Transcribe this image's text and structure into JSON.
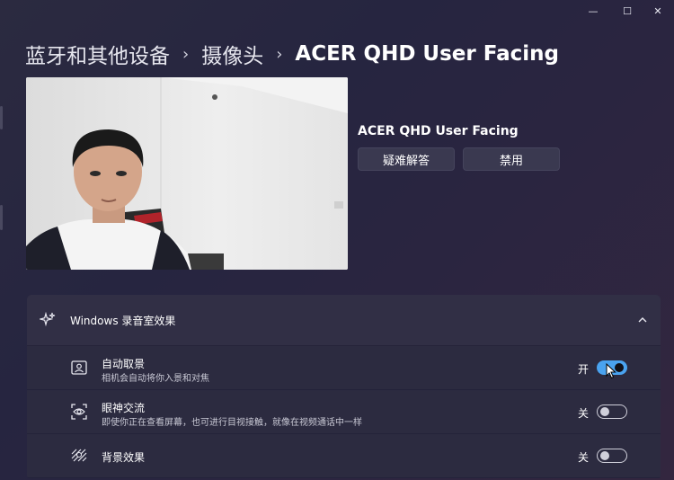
{
  "window": {
    "minimize_glyph": "—",
    "maximize_glyph": "☐",
    "close_glyph": "✕"
  },
  "breadcrumb": {
    "level1": "蓝牙和其他设备",
    "level2": "摄像头",
    "current": "ACER QHD User Facing",
    "separator": "›"
  },
  "camera": {
    "device_name": "ACER QHD User Facing",
    "troubleshoot_label": "疑难解答",
    "disable_label": "禁用"
  },
  "studio_effects": {
    "header_label": "Windows 录音室效果",
    "header_icon": "sparkle-icon",
    "expanded": true,
    "items": [
      {
        "title": "自动取景",
        "description": "相机会自动将你入景和对焦",
        "state_label": "开",
        "enabled": true,
        "icon": "portrait-frame-icon"
      },
      {
        "title": "眼神交流",
        "description": "即使你正在查看屏幕，也可进行目视接触，就像在视频通话中一样",
        "state_label": "关",
        "enabled": false,
        "icon": "eye-contact-icon"
      },
      {
        "title": "背景效果",
        "description": "",
        "state_label": "关",
        "enabled": false,
        "icon": "background-blur-icon"
      }
    ]
  },
  "colors": {
    "accent": "#4aa3f0",
    "background": "#272640",
    "card": "#2c2b40"
  }
}
